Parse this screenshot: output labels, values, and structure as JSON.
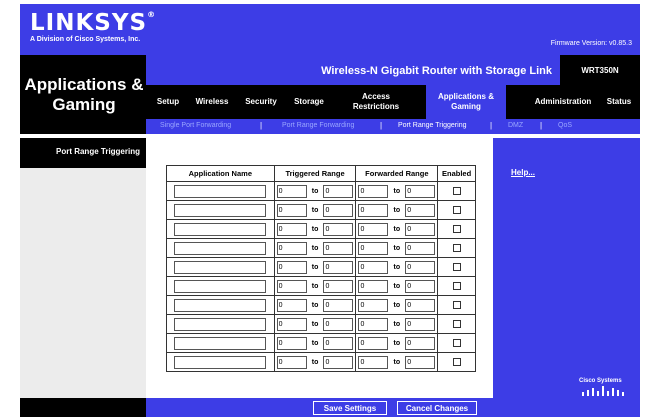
{
  "brand": {
    "logo": "LINKSYS",
    "logo_mark": "®",
    "subtitle": "A Division of Cisco Systems, Inc."
  },
  "firmware": "Firmware Version: v0.85.3",
  "section_title": "Applications & Gaming",
  "product": {
    "name": "Wireless-N Gigabit Router with Storage Link",
    "model": "WRT350N"
  },
  "tabs": [
    {
      "label": "Setup"
    },
    {
      "label": "Wireless"
    },
    {
      "label": "Security"
    },
    {
      "label": "Storage"
    },
    {
      "label": "Access Restrictions"
    },
    {
      "label": "Applications & Gaming"
    },
    {
      "label": "Administration"
    },
    {
      "label": "Status"
    }
  ],
  "subnav": [
    {
      "label": "Single Port Forwarding"
    },
    {
      "label": "Port Range Forwarding"
    },
    {
      "label": "Port Range Triggering"
    },
    {
      "label": "DMZ"
    },
    {
      "label": "QoS"
    }
  ],
  "subnav_separator": "|",
  "sidebar": {
    "label": "Port Range Triggering"
  },
  "table": {
    "headers": {
      "name": "Application Name",
      "triggered": "Triggered Range",
      "forwarded": "Forwarded Range",
      "enabled": "Enabled"
    },
    "to_label": "to",
    "rows": [
      {
        "name": "",
        "trig_start": "0",
        "trig_end": "0",
        "fwd_start": "0",
        "fwd_end": "0",
        "enabled": false
      },
      {
        "name": "",
        "trig_start": "0",
        "trig_end": "0",
        "fwd_start": "0",
        "fwd_end": "0",
        "enabled": false
      },
      {
        "name": "",
        "trig_start": "0",
        "trig_end": "0",
        "fwd_start": "0",
        "fwd_end": "0",
        "enabled": false
      },
      {
        "name": "",
        "trig_start": "0",
        "trig_end": "0",
        "fwd_start": "0",
        "fwd_end": "0",
        "enabled": false
      },
      {
        "name": "",
        "trig_start": "0",
        "trig_end": "0",
        "fwd_start": "0",
        "fwd_end": "0",
        "enabled": false
      },
      {
        "name": "",
        "trig_start": "0",
        "trig_end": "0",
        "fwd_start": "0",
        "fwd_end": "0",
        "enabled": false
      },
      {
        "name": "",
        "trig_start": "0",
        "trig_end": "0",
        "fwd_start": "0",
        "fwd_end": "0",
        "enabled": false
      },
      {
        "name": "",
        "trig_start": "0",
        "trig_end": "0",
        "fwd_start": "0",
        "fwd_end": "0",
        "enabled": false
      },
      {
        "name": "",
        "trig_start": "0",
        "trig_end": "0",
        "fwd_start": "0",
        "fwd_end": "0",
        "enabled": false
      },
      {
        "name": "",
        "trig_start": "0",
        "trig_end": "0",
        "fwd_start": "0",
        "fwd_end": "0",
        "enabled": false
      }
    ]
  },
  "help": {
    "label": "Help..."
  },
  "cisco_logo": "Cisco Systems",
  "buttons": {
    "save": "Save Settings",
    "cancel": "Cancel Changes"
  },
  "colors": {
    "brand_blue": "#3d3de6",
    "black": "#000000",
    "inactive_link": "#9aa6ff"
  }
}
